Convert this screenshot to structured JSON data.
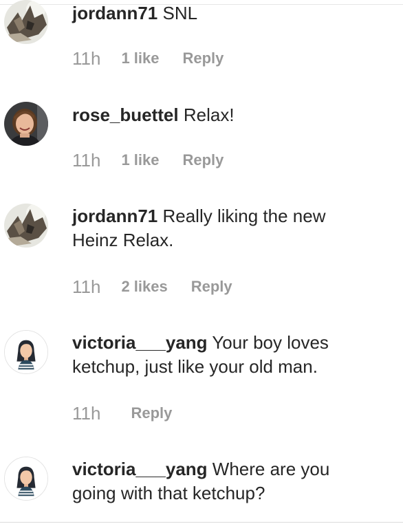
{
  "comments": [
    {
      "username": "jordann71",
      "text": "SNL",
      "time": "11h",
      "likes": "1 like",
      "reply": "Reply",
      "avatar": "outdoor-photo-avatar"
    },
    {
      "username": "rose_buettel",
      "text": "Relax!",
      "time": "11h",
      "likes": "1 like",
      "reply": "Reply",
      "avatar": "portrait-photo-avatar"
    },
    {
      "username": "jordann71",
      "text": "Really liking the new Heinz Relax.",
      "time": "11h",
      "likes": "2 likes",
      "reply": "Reply",
      "avatar": "outdoor-photo-avatar"
    },
    {
      "username": "victoria___yang",
      "text": "Your boy loves ketchup, just like your old man.",
      "time": "11h",
      "likes": "",
      "reply": "Reply",
      "avatar": "cartoon-girl-avatar"
    },
    {
      "username": "victoria___yang",
      "text": "Where are you going with that ketchup?",
      "avatar": "cartoon-girl-avatar"
    }
  ],
  "colors": {
    "text": "#262626",
    "secondary": "#999999",
    "divider": "#dbdbdb"
  }
}
